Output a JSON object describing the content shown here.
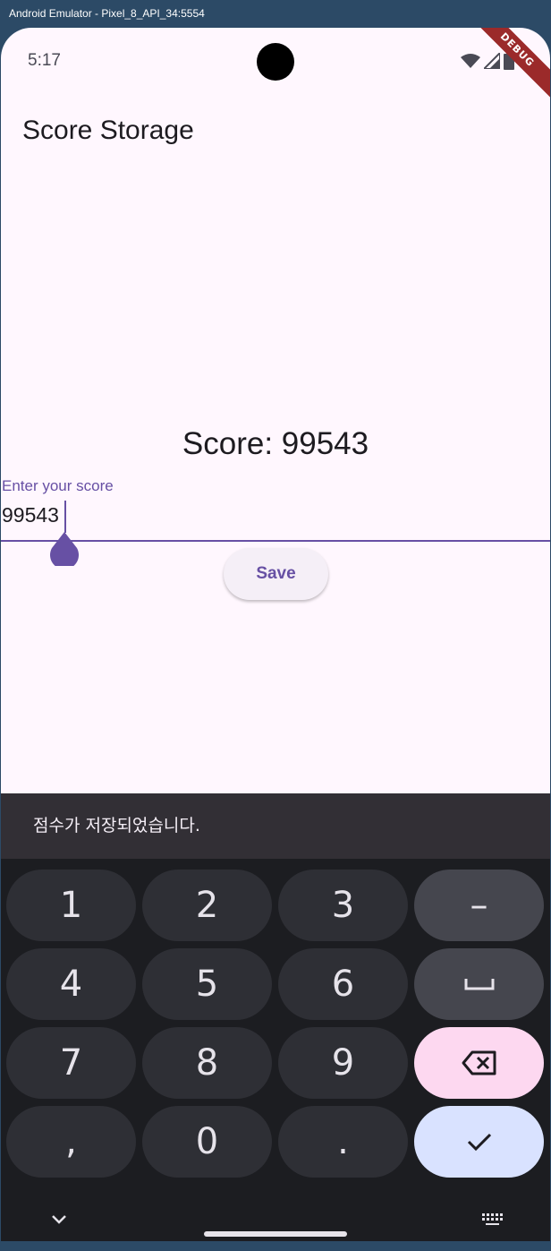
{
  "window": {
    "title": "Android Emulator - Pixel_8_API_34:5554"
  },
  "status_bar": {
    "time": "5:17",
    "icons": [
      "wifi-icon",
      "signal-icon",
      "battery-icon"
    ],
    "debug_banner": "DEBUG"
  },
  "app": {
    "title": "Score Storage"
  },
  "main": {
    "score_text": "Score: 99543",
    "input": {
      "label": "Enter your score",
      "value": "99543"
    },
    "save_label": "Save"
  },
  "snackbar": {
    "message": "점수가 저장되었습니다."
  },
  "keyboard": {
    "keys": [
      [
        "1",
        "2",
        "3",
        "–"
      ],
      [
        "4",
        "5",
        "6",
        "space"
      ],
      [
        "7",
        "8",
        "9",
        "backspace"
      ],
      [
        ",",
        "0",
        ".",
        "done"
      ]
    ],
    "bottom_icons": [
      "chevron-down-icon",
      "keyboard-icon"
    ]
  },
  "colors": {
    "accent": "#6750a4",
    "background": "#fff7fe",
    "snackbar": "#322f35",
    "keyboard": "#1c1d21",
    "backspace_key": "#fdd8f0",
    "enter_key": "#d9e2ff"
  }
}
